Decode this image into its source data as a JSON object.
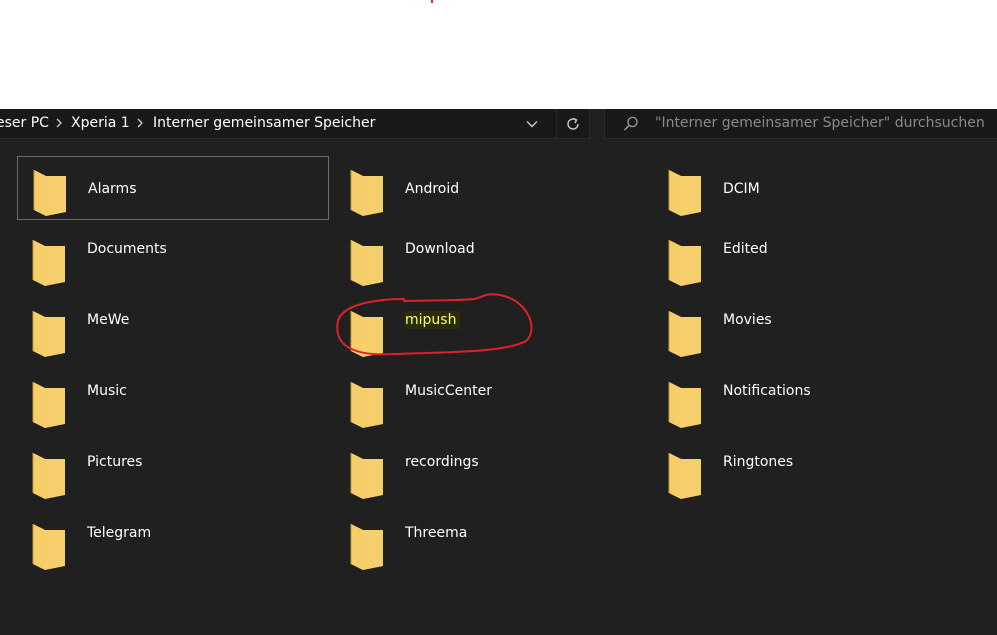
{
  "breadcrumb": {
    "items": [
      "eser PC",
      "Xperia 1",
      "Interner gemeinsamer Speicher"
    ]
  },
  "search": {
    "placeholder": "\"Interner gemeinsamer Speicher\" durchsuchen"
  },
  "folders": [
    {
      "label": "Alarms",
      "selected": true
    },
    {
      "label": "Android"
    },
    {
      "label": "DCIM"
    },
    {
      "label": "Documents"
    },
    {
      "label": "Download"
    },
    {
      "label": "Edited"
    },
    {
      "label": "MeWe"
    },
    {
      "label": "mipush",
      "highlighted": true,
      "annotated": true
    },
    {
      "label": "Movies"
    },
    {
      "label": "Music"
    },
    {
      "label": "MusicCenter"
    },
    {
      "label": "Notifications"
    },
    {
      "label": "Pictures"
    },
    {
      "label": "recordings"
    },
    {
      "label": "Ringtones"
    },
    {
      "label": "Telegram"
    },
    {
      "label": "Threema"
    }
  ],
  "colors": {
    "background": "#202020",
    "folder": "#f5cf6b",
    "folder_back": "#e8b84c",
    "annotation": "#e0202a",
    "highlight_text": "#ffff66"
  },
  "icons": {
    "folder": "folder-icon",
    "search": "search-icon",
    "dropdown": "chevron-down-icon",
    "refresh": "refresh-icon",
    "separator": "chevron-right-icon"
  }
}
